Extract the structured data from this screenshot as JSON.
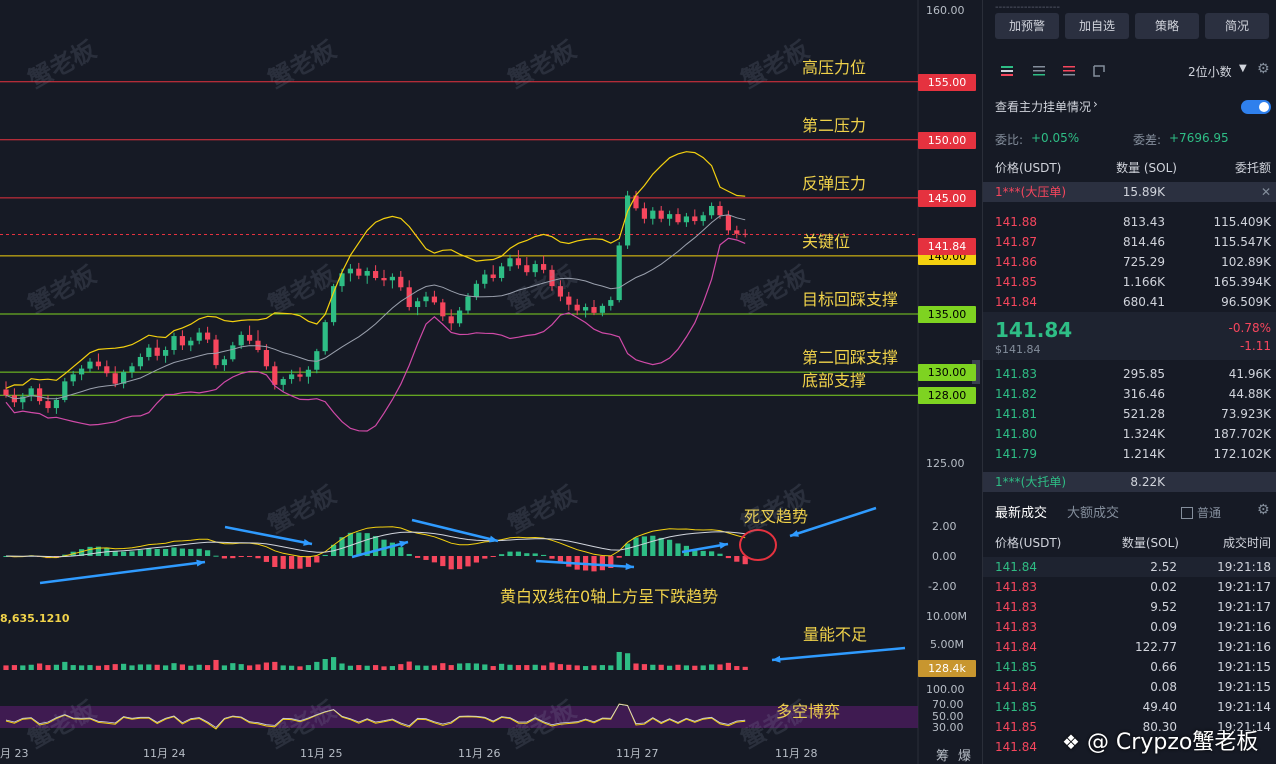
{
  "price_levels": [
    {
      "price": "155.00",
      "label": "高压力位",
      "color": "#e5323f"
    },
    {
      "price": "150.00",
      "label": "第二压力",
      "color": "#e5323f"
    },
    {
      "price": "145.00",
      "label": "反弹压力",
      "color": "#e5323f"
    },
    {
      "price": "140.00",
      "label": "关键位",
      "color": "#f3d00f"
    },
    {
      "price": "135.00",
      "label": "目标回踩支撑",
      "color": "#7ed321"
    },
    {
      "price": "130.00",
      "label": "第二回踩支撑",
      "color": "#7ed321"
    },
    {
      "price": "128.00",
      "label": "底部支撑",
      "color": "#7ed321"
    }
  ],
  "current_price_tag": "141.84",
  "axis_prices": [
    "160.00",
    "125.00"
  ],
  "macd_axis": [
    "2.00",
    "0.00",
    "-2.00"
  ],
  "volume_axis": [
    "10.00M",
    "5.00M"
  ],
  "volume_tag": "128.4k",
  "rsi_axis": [
    "100.00",
    "70.00",
    "50.00",
    "30.00"
  ],
  "volume_readout": "8,635.1210",
  "dates": [
    "月 23",
    "11月 24",
    "11月 25",
    "11月 26",
    "11月 27",
    "11月 28"
  ],
  "right_axis_extra": [
    "筹",
    "爆"
  ],
  "annotations": {
    "dead_cross": "死叉趋势",
    "macd_note": "黄白双线在0轴上方呈下跌趋势",
    "volume_note": "量能不足",
    "rsi_note": "多空博弈"
  },
  "watermark": "蟹老板",
  "credit": "@ Crypzo蟹老板",
  "panel": {
    "buttons": [
      "加预警",
      "加自选",
      "策略",
      "简况"
    ],
    "decimals": "2位小数",
    "depth_toggle": "查看主力挂单情况",
    "ratio_label": "委比:",
    "ratio_value": "+0.05%",
    "diff_label": "委差:",
    "diff_value": "+7696.95",
    "headers": [
      "价格(USDT)",
      "数量 (SOL)",
      "委托额"
    ],
    "big_ask": {
      "label": "1***(大压单)",
      "value": "15.89K"
    },
    "asks": [
      {
        "p": "141.88",
        "q": "813.43",
        "t": "115.409K"
      },
      {
        "p": "141.87",
        "q": "814.46",
        "t": "115.547K"
      },
      {
        "p": "141.86",
        "q": "725.29",
        "t": "102.89K"
      },
      {
        "p": "141.85",
        "q": "1.166K",
        "t": "165.394K"
      },
      {
        "p": "141.84",
        "q": "680.41",
        "t": "96.509K"
      }
    ],
    "last_price": "141.84",
    "last_usd": "$141.84",
    "change_pct": "-0.78%",
    "change_abs": "-1.11",
    "bids": [
      {
        "p": "141.83",
        "q": "295.85",
        "t": "41.96K"
      },
      {
        "p": "141.82",
        "q": "316.46",
        "t": "44.88K"
      },
      {
        "p": "141.81",
        "q": "521.28",
        "t": "73.923K"
      },
      {
        "p": "141.80",
        "q": "1.324K",
        "t": "187.702K"
      },
      {
        "p": "141.79",
        "q": "1.214K",
        "t": "172.102K"
      }
    ],
    "big_bid": {
      "label": "1***(大托单)",
      "value": "8.22K"
    },
    "trade_tabs": [
      "最新成交",
      "大额成交"
    ],
    "normal_label": "普通",
    "trade_headers": [
      "价格(USDT)",
      "数量(SOL)",
      "成交时间"
    ],
    "trades": [
      {
        "p": "141.84",
        "q": "2.52",
        "t": "19:21:18",
        "side": "g"
      },
      {
        "p": "141.83",
        "q": "0.02",
        "t": "19:21:17",
        "side": "r"
      },
      {
        "p": "141.83",
        "q": "9.52",
        "t": "19:21:17",
        "side": "r"
      },
      {
        "p": "141.83",
        "q": "0.09",
        "t": "19:21:16",
        "side": "r"
      },
      {
        "p": "141.84",
        "q": "122.77",
        "t": "19:21:16",
        "side": "r"
      },
      {
        "p": "141.85",
        "q": "0.66",
        "t": "19:21:15",
        "side": "g"
      },
      {
        "p": "141.84",
        "q": "0.08",
        "t": "19:21:15",
        "side": "r"
      },
      {
        "p": "141.85",
        "q": "49.40",
        "t": "19:21:14",
        "side": "g"
      },
      {
        "p": "141.85",
        "q": "80.30",
        "t": "19:21:14",
        "side": "r"
      },
      {
        "p": "141.84",
        "q": "",
        "t": "",
        "side": "r"
      }
    ]
  },
  "chart_data": {
    "type": "candlestick",
    "title": "",
    "ylim": [
      122,
      161
    ],
    "y_ticks": [
      160,
      125
    ],
    "horizontal_levels": [
      155,
      150,
      145,
      140,
      135,
      130,
      128
    ],
    "current_price": 141.84,
    "x_labels": [
      "月 23",
      "11月 24",
      "11月 25",
      "11月 26",
      "11月 27",
      "11月 28"
    ],
    "candles": [
      [
        128.5,
        129.2,
        127.8,
        128.0
      ],
      [
        128.0,
        128.6,
        127.0,
        127.4
      ],
      [
        127.4,
        128.2,
        126.8,
        127.9
      ],
      [
        127.9,
        128.8,
        127.5,
        128.6
      ],
      [
        128.6,
        129.0,
        127.2,
        127.5
      ],
      [
        127.5,
        128.0,
        126.5,
        126.9
      ],
      [
        126.9,
        127.8,
        126.4,
        127.6
      ],
      [
        127.6,
        129.5,
        127.4,
        129.2
      ],
      [
        129.2,
        130.1,
        128.8,
        129.8
      ],
      [
        129.8,
        130.6,
        129.3,
        130.3
      ],
      [
        130.3,
        131.2,
        130.0,
        130.9
      ],
      [
        130.9,
        131.6,
        130.2,
        130.5
      ],
      [
        130.5,
        131.0,
        129.6,
        129.9
      ],
      [
        129.9,
        130.5,
        128.7,
        129.0
      ],
      [
        129.0,
        130.2,
        128.6,
        130.0
      ],
      [
        130.0,
        130.8,
        129.5,
        130.5
      ],
      [
        130.5,
        131.6,
        130.2,
        131.3
      ],
      [
        131.3,
        132.4,
        131.0,
        132.1
      ],
      [
        132.1,
        132.8,
        131.0,
        131.4
      ],
      [
        131.4,
        132.2,
        130.8,
        131.9
      ],
      [
        131.9,
        133.4,
        131.5,
        133.1
      ],
      [
        133.1,
        133.6,
        131.9,
        132.3
      ],
      [
        132.3,
        133.0,
        131.8,
        132.7
      ],
      [
        132.7,
        133.8,
        132.4,
        133.4
      ],
      [
        133.4,
        133.9,
        132.5,
        132.8
      ],
      [
        132.8,
        133.2,
        130.3,
        130.6
      ],
      [
        130.6,
        131.4,
        130.1,
        131.1
      ],
      [
        131.1,
        132.6,
        130.9,
        132.3
      ],
      [
        132.3,
        133.5,
        132.0,
        133.2
      ],
      [
        133.2,
        134.0,
        132.4,
        132.7
      ],
      [
        132.7,
        133.6,
        131.7,
        131.9
      ],
      [
        131.9,
        132.4,
        130.2,
        130.5
      ],
      [
        130.5,
        130.9,
        128.5,
        128.9
      ],
      [
        128.9,
        129.6,
        128.3,
        129.4
      ],
      [
        129.4,
        130.2,
        129.0,
        129.8
      ],
      [
        129.8,
        130.4,
        129.2,
        129.6
      ],
      [
        129.6,
        130.5,
        129.0,
        130.2
      ],
      [
        130.2,
        132.0,
        129.9,
        131.8
      ],
      [
        131.8,
        134.5,
        131.5,
        134.3
      ],
      [
        134.3,
        137.6,
        134.0,
        137.4
      ],
      [
        137.4,
        138.9,
        136.9,
        138.5
      ],
      [
        138.5,
        139.3,
        137.8,
        138.9
      ],
      [
        138.9,
        139.4,
        138.0,
        138.3
      ],
      [
        138.3,
        139.0,
        137.6,
        138.7
      ],
      [
        138.7,
        139.2,
        137.9,
        138.1
      ],
      [
        138.1,
        138.8,
        137.4,
        137.9
      ],
      [
        137.9,
        138.5,
        137.2,
        138.2
      ],
      [
        138.2,
        138.7,
        137.0,
        137.3
      ],
      [
        137.3,
        137.9,
        135.3,
        135.6
      ],
      [
        135.6,
        136.4,
        134.9,
        136.1
      ],
      [
        136.1,
        136.9,
        135.6,
        136.5
      ],
      [
        136.5,
        137.0,
        135.8,
        136.0
      ],
      [
        136.0,
        136.3,
        134.4,
        134.8
      ],
      [
        134.8,
        135.4,
        133.6,
        134.2
      ],
      [
        134.2,
        135.6,
        133.9,
        135.3
      ],
      [
        135.3,
        136.8,
        135.0,
        136.5
      ],
      [
        136.5,
        137.9,
        136.2,
        137.6
      ],
      [
        137.6,
        138.8,
        137.2,
        138.4
      ],
      [
        138.4,
        139.2,
        137.8,
        138.1
      ],
      [
        138.1,
        139.4,
        137.8,
        139.1
      ],
      [
        139.1,
        140.1,
        138.7,
        139.8
      ],
      [
        139.8,
        140.5,
        138.9,
        139.2
      ],
      [
        139.2,
        139.9,
        138.3,
        138.6
      ],
      [
        138.6,
        139.6,
        138.2,
        139.3
      ],
      [
        139.3,
        140.0,
        138.5,
        138.8
      ],
      [
        138.8,
        139.2,
        137.0,
        137.4
      ],
      [
        137.4,
        137.9,
        136.1,
        136.5
      ],
      [
        136.5,
        136.9,
        135.3,
        135.8
      ],
      [
        135.8,
        136.3,
        134.9,
        135.3
      ],
      [
        135.3,
        135.9,
        134.7,
        135.6
      ],
      [
        135.6,
        136.2,
        134.9,
        135.1
      ],
      [
        135.1,
        135.9,
        134.8,
        135.7
      ],
      [
        135.7,
        136.5,
        135.3,
        136.2
      ],
      [
        136.2,
        141.2,
        136.0,
        140.9
      ],
      [
        140.9,
        145.6,
        140.6,
        145.2
      ],
      [
        145.2,
        145.6,
        143.9,
        144.1
      ],
      [
        144.1,
        144.6,
        142.8,
        143.2
      ],
      [
        143.2,
        144.2,
        142.7,
        143.9
      ],
      [
        143.9,
        144.3,
        142.9,
        143.2
      ],
      [
        143.2,
        143.9,
        142.6,
        143.6
      ],
      [
        143.6,
        144.1,
        142.7,
        142.9
      ],
      [
        142.9,
        143.7,
        142.5,
        143.4
      ],
      [
        143.4,
        144.0,
        142.7,
        143.0
      ],
      [
        143.0,
        143.8,
        142.6,
        143.5
      ],
      [
        143.5,
        144.6,
        143.2,
        144.3
      ],
      [
        144.3,
        144.7,
        143.2,
        143.5
      ],
      [
        143.5,
        143.9,
        141.9,
        142.2
      ],
      [
        142.2,
        142.6,
        141.5,
        141.9
      ],
      [
        141.9,
        142.3,
        141.6,
        141.84
      ]
    ]
  }
}
